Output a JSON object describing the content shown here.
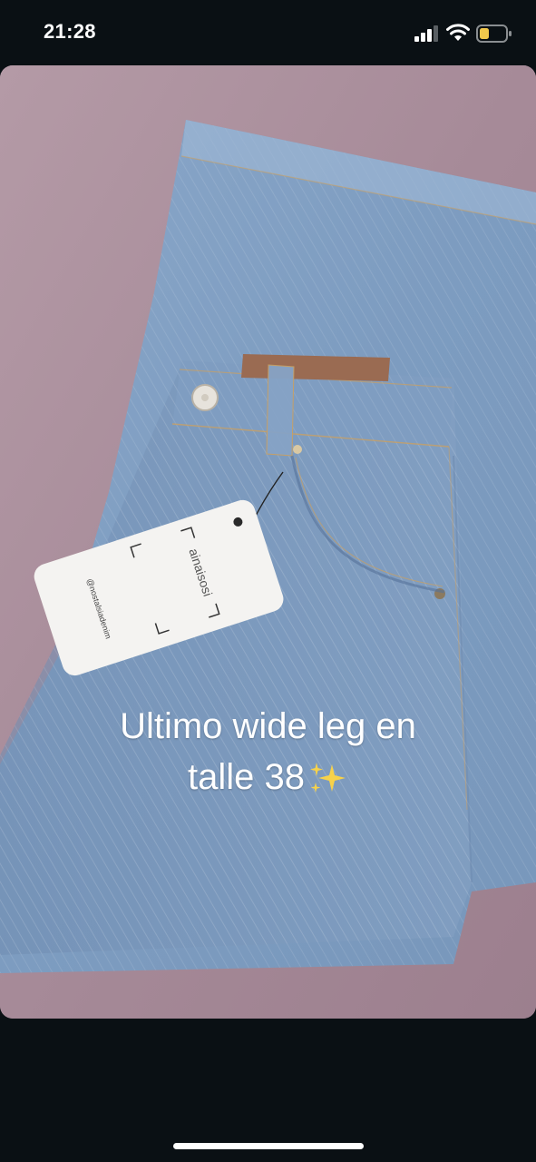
{
  "status_bar": {
    "time": "21:28",
    "signal_icon": "cellular-signal-icon",
    "wifi_icon": "wifi-icon",
    "battery_icon": "battery-low-icon",
    "battery_color": "#f2c94c"
  },
  "story": {
    "caption_line1": "Ultimo wide leg en",
    "caption_line2": "talle 38",
    "caption_emoji": "sparkles-icon",
    "tag_brand": "ainaisosi",
    "tag_handle": "@nostalsiadenim",
    "background_color": "#a78c98",
    "denim_color": "#7f9ec2"
  },
  "home_indicator": {
    "color": "#ffffff"
  }
}
